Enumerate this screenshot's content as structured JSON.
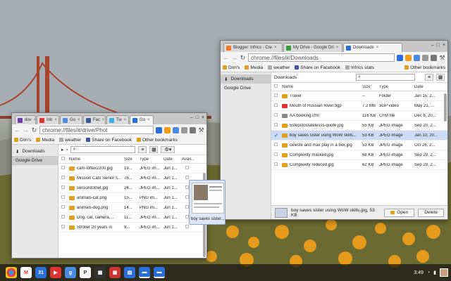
{
  "win_left": {
    "tabs": [
      "dov",
      "Inb",
      "Go",
      "Fac",
      "Tw",
      "Go"
    ],
    "url": "chrome://files/#/drive/Phot",
    "bookmarks": [
      "Don's",
      "Media",
      "weather",
      "Share on Facebook",
      "Other bookmarks"
    ],
    "sidebar": [
      "Downloads",
      "Google Drive"
    ],
    "toolbar": {
      "path_arrow": "›"
    },
    "columns": [
      "Name",
      "Size",
      "Type",
      "Date",
      "Avail..."
    ],
    "rows": [
      {
        "name": "cam-loftex2200.jpg",
        "size": "19...",
        "type": "JPEG im...",
        "date": "Jun 1..."
      },
      {
        "name": "Mission Cats Senior s...",
        "size": "76...",
        "type": "JPEG im...",
        "date": "Jun 1..."
      },
      {
        "name": "sensordotnet.jpg",
        "size": "24...",
        "type": "JPEG im...",
        "date": "Jun 1..."
      },
      {
        "name": "animals-cat.png",
        "size": "15...",
        "type": "PNG im...",
        "date": "Jun 1..."
      },
      {
        "name": "animals-dog.png",
        "size": "14...",
        "type": "PNG im...",
        "date": "Jun 1..."
      },
      {
        "name": "Dog, cat, camera, ..",
        "size": "11...",
        "type": "JPEG im...",
        "date": "Jun 1..."
      },
      {
        "name": "Stroller 20 years in",
        "size": "9...",
        "type": "JPEG im...",
        "date": "Jun 1..."
      }
    ]
  },
  "win_right": {
    "tabs": [
      "Blogger: Infrics - Cre",
      "My Drive - Google Dri",
      "Downloads"
    ],
    "url": "chrome://files/#/Downloads",
    "bookmarks": [
      "Don's",
      "Media",
      "weather",
      "Share on Facebook",
      "Infrics stats",
      "Other bookmarks"
    ],
    "sidebar": [
      "Downloads",
      "Google Drive"
    ],
    "breadcrumb": "Downloads",
    "columns": [
      "Name",
      "Size",
      "Type",
      "Date"
    ],
    "rows": [
      {
        "name": "Travel",
        "size": "--",
        "type": "Folder",
        "date": "Jan 15, 2...",
        "kind": "folder"
      },
      {
        "name": "Mouth of Russian River.3gp",
        "size": "7.2 MB",
        "type": "3GP video",
        "date": "May 21, ...",
        "kind": "video"
      },
      {
        "name": "AA booking.cfm",
        "size": "116 KB",
        "type": "CFM file",
        "date": "Dec 8, 20...",
        "kind": "file"
      },
      {
        "name": "5stepstostatelesss-quote.jpg",
        "size": "55 KB",
        "type": "JPEG image",
        "date": "Sep 20, 2...",
        "kind": "image"
      },
      {
        "name": "boy saves sister using WoW skills...",
        "size": "53 KB",
        "type": "JPEG image",
        "date": "Jan 10, 20...",
        "kind": "image",
        "selected": true
      },
      {
        "name": "celeste and max play in a box.jpg",
        "size": "53 KB",
        "type": "JPEG image",
        "date": "Oct 26, 2...",
        "kind": "image"
      },
      {
        "name": "Complexity masked.jpg",
        "size": "68 KB",
        "type": "JPEG image",
        "date": "Sep 29, 2...",
        "kind": "image"
      },
      {
        "name": "Complexity reduced.jpg",
        "size": "62 KB",
        "type": "JPEG image",
        "date": "Sep 29, 2...",
        "kind": "image"
      }
    ],
    "footer": {
      "selection": "boy saves sister using WoW skills.jpg, 53 KB",
      "open": "Open",
      "delete": "Delete"
    }
  },
  "drag_item": "boy saves sister...",
  "shelf": {
    "clock": "3:49",
    "apps": [
      "chrome-icon",
      "gmail-icon",
      "calendar-icon",
      "youtube-icon",
      "google-search-icon",
      "play-icon",
      "movies-icon",
      "photos-icon",
      "docs-icon",
      "files-icon",
      "files-icon-2"
    ]
  },
  "colors": {
    "accent": "#4a7bd0",
    "selection": "#cddcf5"
  }
}
